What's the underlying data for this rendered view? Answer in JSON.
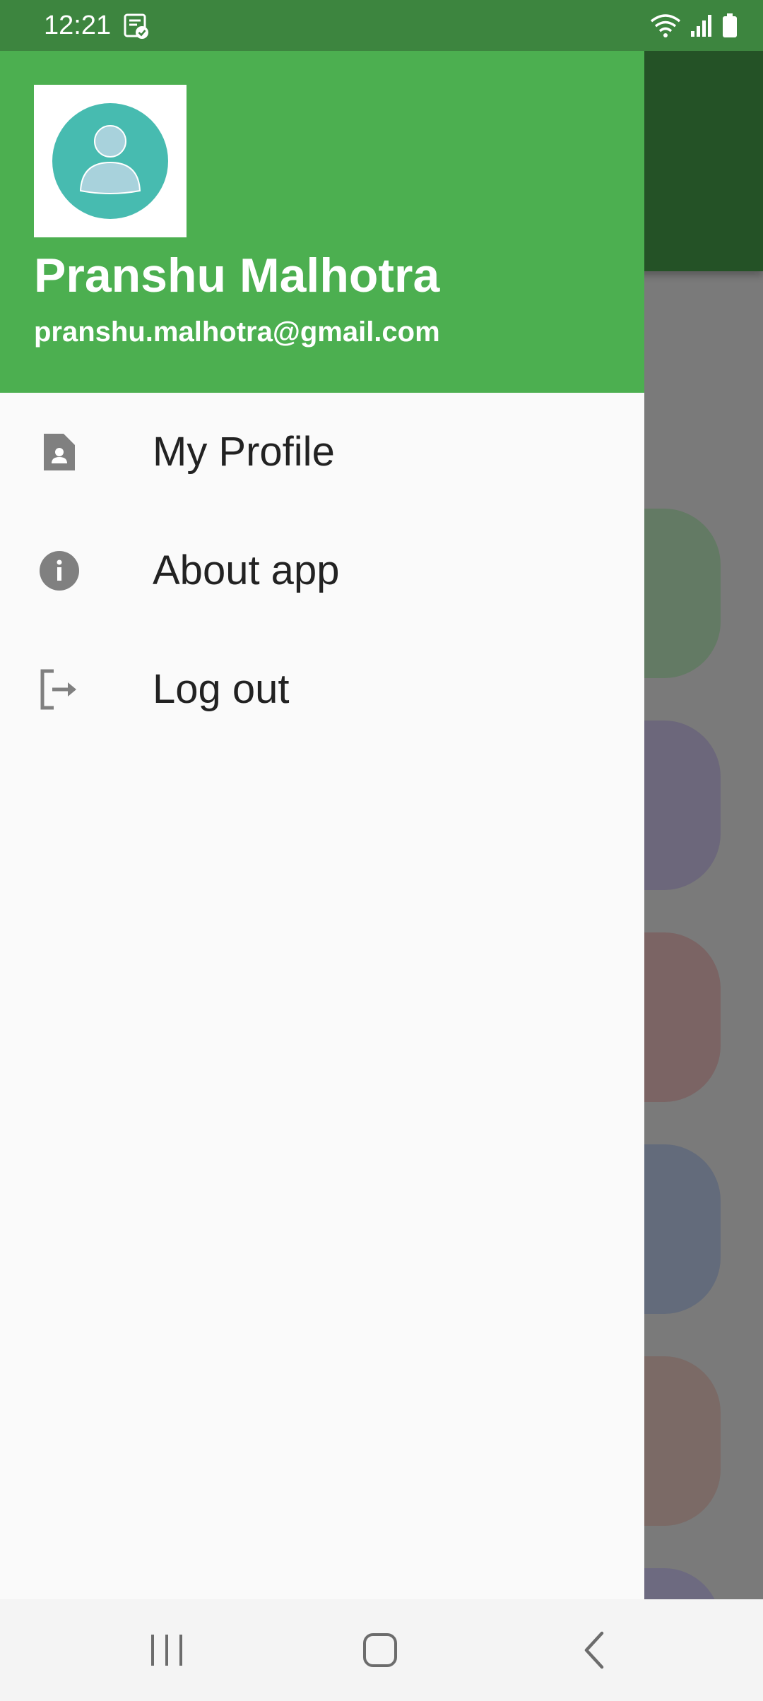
{
  "status_bar": {
    "time": "12:21",
    "notification_icon": "task-check-icon",
    "icons": [
      "wifi-icon",
      "signal-icon",
      "battery-icon"
    ]
  },
  "drawer": {
    "header": {
      "user_name": "Pranshu Malhotra",
      "user_email": "pranshu.malhotra@gmail.com",
      "avatar_icon": "person-avatar-icon",
      "background_color": "#4caf50"
    },
    "menu_items": [
      {
        "label": "My Profile",
        "icon": "profile-document-icon"
      },
      {
        "label": "About app",
        "icon": "info-icon"
      },
      {
        "label": "Log out",
        "icon": "logout-icon"
      }
    ]
  },
  "nav_bar": {
    "buttons": [
      "recent-apps-icon",
      "home-icon",
      "back-icon"
    ]
  },
  "colors": {
    "accent": "#4caf50",
    "status_bar": "#3d853f",
    "scrim": "#7a7a7a",
    "icon_gray": "#808080"
  }
}
